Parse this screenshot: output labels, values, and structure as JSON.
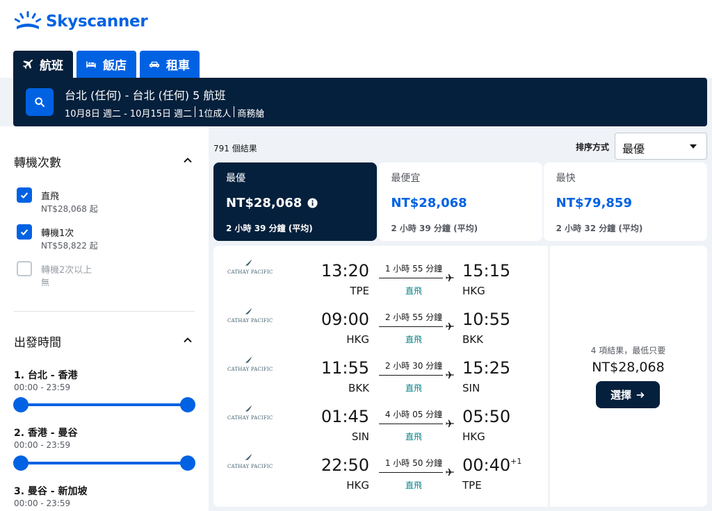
{
  "brand": {
    "name": "Skyscanner",
    "color": "#0062e3",
    "dark": "#05203c"
  },
  "tabs": [
    {
      "label": "航班",
      "icon": "plane-icon",
      "active": true
    },
    {
      "label": "飯店",
      "icon": "bed-icon",
      "active": false
    },
    {
      "label": "租車",
      "icon": "car-icon",
      "active": false
    }
  ],
  "search": {
    "route": "台北 (任何) - 台北 (任何) 5 航班",
    "dates": "10月8日 週二 - 10月15日 週二",
    "travelers": "1位成人",
    "cabin": "商務艙"
  },
  "filters": {
    "stops_title": "轉機次數",
    "stops": [
      {
        "label": "直飛",
        "price": "NT$28,068 起",
        "checked": true,
        "disabled": false
      },
      {
        "label": "轉機1次",
        "price": "NT$58,822 起",
        "checked": true,
        "disabled": false
      },
      {
        "label": "轉機2次以上",
        "price": "無",
        "checked": false,
        "disabled": true
      }
    ],
    "departure_title": "出發時間",
    "legs": [
      {
        "title": "1. 台北 - 香港",
        "range": "00:00 - 23:59"
      },
      {
        "title": "2. 香港 - 曼谷",
        "range": "00:00 - 23:59"
      },
      {
        "title": "3. 曼谷 - 新加坡",
        "range": "00:00 - 23:59"
      }
    ]
  },
  "results": {
    "count": "791 個結果",
    "sort_label": "排序方式",
    "sort_value": "最優"
  },
  "sort_tabs": [
    {
      "name": "最優",
      "price": "NT$28,068",
      "duration": "2 小時 39 分鐘 (平均)",
      "active": true
    },
    {
      "name": "最便宜",
      "price": "NT$28,068",
      "duration": "2 小時 39 分鐘 (平均)",
      "active": false
    },
    {
      "name": "最快",
      "price": "NT$79,859",
      "duration": "2 小時 32 分鐘 (平均)",
      "active": false
    }
  ],
  "itinerary": {
    "airline": "CATHAY PACIFIC",
    "legs": [
      {
        "dep_time": "13:20",
        "dep_code": "TPE",
        "duration": "1 小時 55 分鐘",
        "stops": "直飛",
        "arr_time": "15:15",
        "arr_code": "HKG",
        "day_offset": ""
      },
      {
        "dep_time": "09:00",
        "dep_code": "HKG",
        "duration": "2 小時 55 分鐘",
        "stops": "直飛",
        "arr_time": "10:55",
        "arr_code": "BKK",
        "day_offset": ""
      },
      {
        "dep_time": "11:55",
        "dep_code": "BKK",
        "duration": "2 小時 30 分鐘",
        "stops": "直飛",
        "arr_time": "15:25",
        "arr_code": "SIN",
        "day_offset": ""
      },
      {
        "dep_time": "01:45",
        "dep_code": "SIN",
        "duration": "4 小時 05 分鐘",
        "stops": "直飛",
        "arr_time": "05:50",
        "arr_code": "HKG",
        "day_offset": ""
      },
      {
        "dep_time": "22:50",
        "dep_code": "HKG",
        "duration": "1 小時 50 分鐘",
        "stops": "直飛",
        "arr_time": "00:40",
        "arr_code": "TPE",
        "day_offset": "+1"
      }
    ],
    "summary_count": "4 項結果，最低只要",
    "summary_price": "NT$28,068",
    "select_label": "選擇"
  }
}
